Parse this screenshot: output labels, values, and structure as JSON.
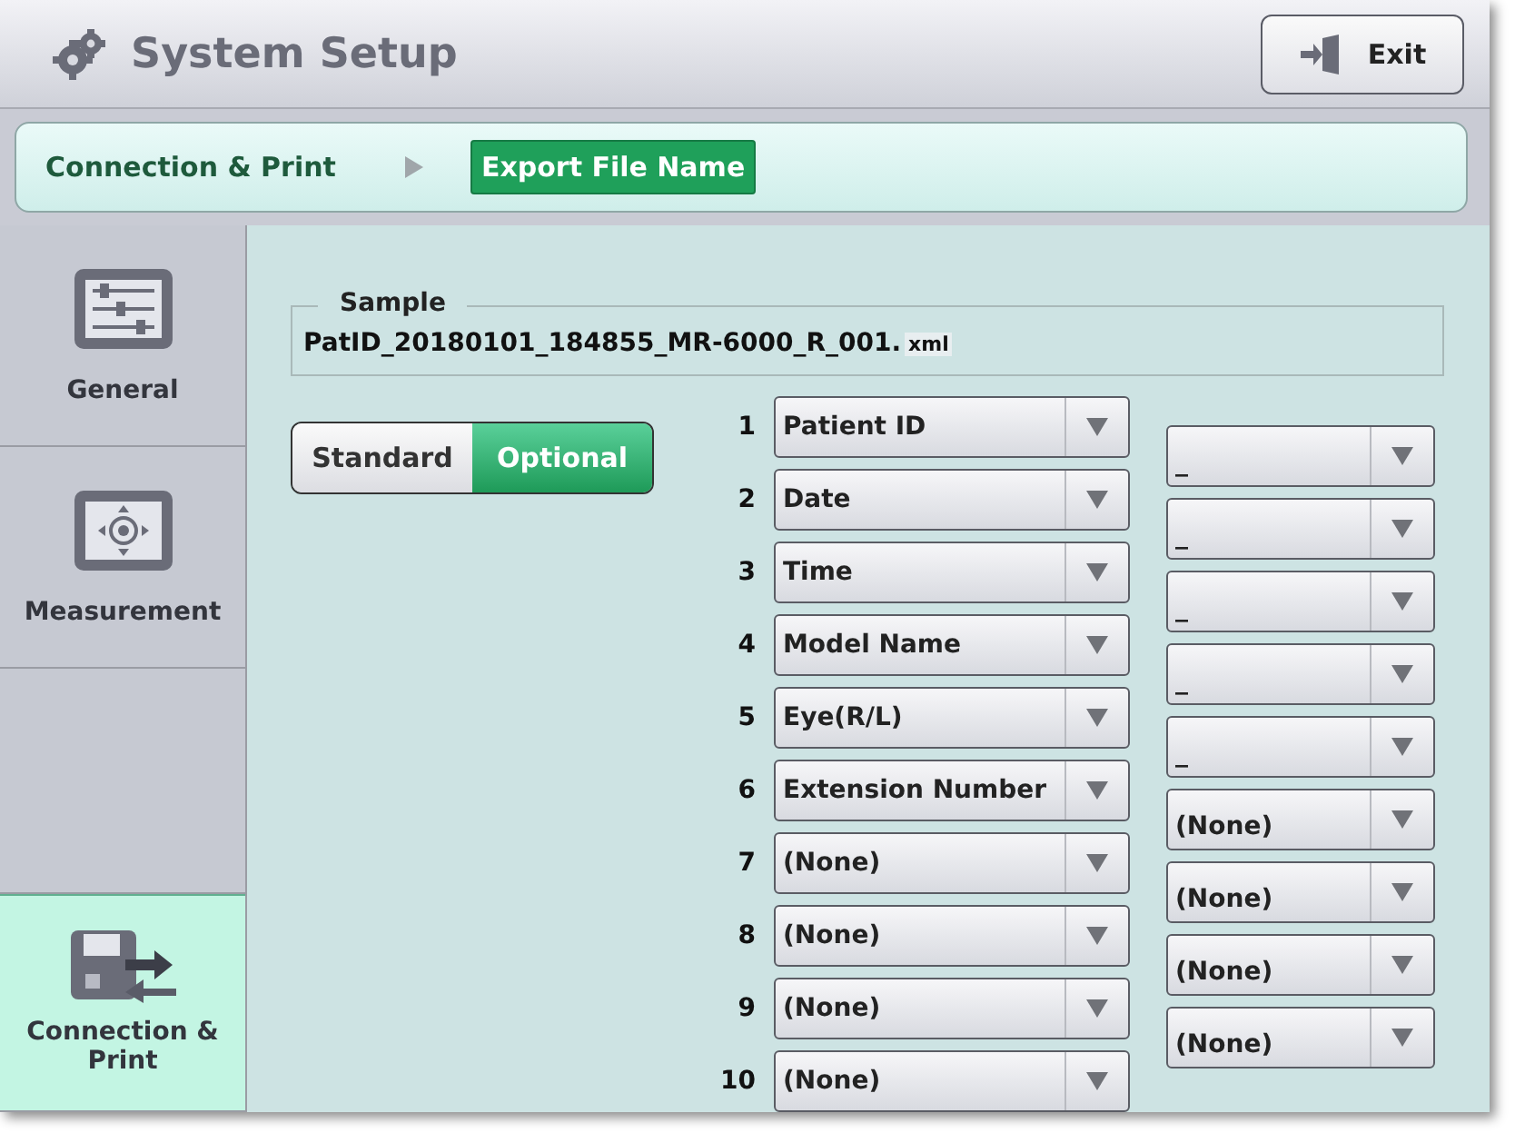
{
  "header": {
    "title": "System Setup",
    "exit_button": "Exit"
  },
  "breadcrumb": [
    {
      "label": "Connection & Print",
      "selected": false
    },
    {
      "label": "Export File Name",
      "selected": true
    }
  ],
  "sidebar": {
    "items": [
      {
        "label": "General",
        "kind": "general",
        "selected": false
      },
      {
        "label": "Measurement",
        "kind": "measurement",
        "selected": false
      },
      {
        "label": "Connection & Print",
        "kind": "connection",
        "selected": true
      }
    ]
  },
  "sample": {
    "legend": "Sample",
    "file_name": "PatID_20180101_184855_MR-6000_R_001.",
    "extension": "xml"
  },
  "mode_toggle": [
    {
      "label": "Standard",
      "selected": false
    },
    {
      "label": "Optional",
      "selected": true
    }
  ],
  "fields": [
    {
      "number": "1",
      "value": "Patient ID"
    },
    {
      "number": "2",
      "value": "Date"
    },
    {
      "number": "3",
      "value": "Time"
    },
    {
      "number": "4",
      "value": "Model Name"
    },
    {
      "number": "5",
      "value": "Eye(R/L)"
    },
    {
      "number": "6",
      "value": "Extension Number"
    },
    {
      "number": "7",
      "value": "(None)"
    },
    {
      "number": "8",
      "value": "(None)"
    },
    {
      "number": "9",
      "value": "(None)"
    },
    {
      "number": "10",
      "value": "(None)"
    }
  ],
  "separators": [
    {
      "value": "_"
    },
    {
      "value": "_"
    },
    {
      "value": "_"
    },
    {
      "value": "_"
    },
    {
      "value": "_"
    },
    {
      "value": "(None)"
    },
    {
      "value": "(None)"
    },
    {
      "value": "(None)"
    },
    {
      "value": "(None)"
    }
  ]
}
